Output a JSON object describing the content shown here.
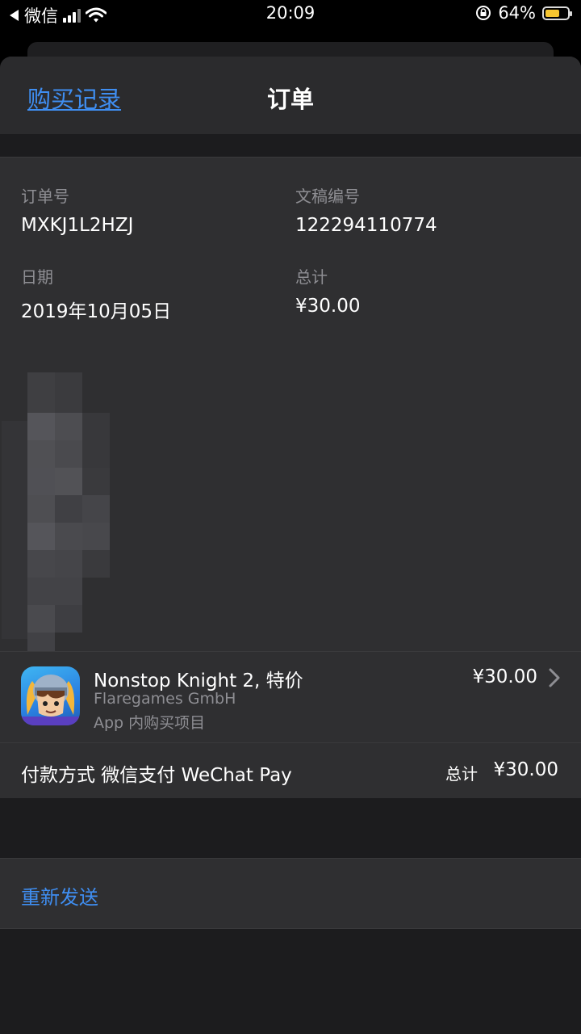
{
  "status_bar": {
    "back_app": "微信",
    "time": "20:09",
    "battery_percent": "64%",
    "battery_level": 0.64,
    "battery_color": "#f6c530"
  },
  "nav": {
    "back_label": "购买记录",
    "title": "订单"
  },
  "order": {
    "order_number_label": "订单号",
    "order_number": "MXKJ1L2HZJ",
    "document_number_label": "文稿编号",
    "document_number": "122294110774",
    "date_label": "日期",
    "date": "2019年10月05日",
    "total_label": "总计",
    "total": "¥30.00"
  },
  "item": {
    "name": "Nonstop Knight 2, 特价",
    "developer": "Flaregames GmbH",
    "type": "App 内购买项目",
    "price": "¥30.00",
    "icon": "knight-app-icon"
  },
  "payment": {
    "label": "付款方式 微信支付 WeChat Pay",
    "total_label": "总计",
    "total": "¥30.00"
  },
  "actions": {
    "resend": "重新发送"
  },
  "colors": {
    "accent": "#3f8ef1",
    "background": "#1c1c1e",
    "cell": "#2f2f31",
    "secondary_text": "#8e8e93"
  }
}
